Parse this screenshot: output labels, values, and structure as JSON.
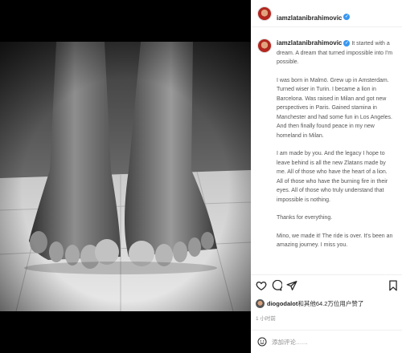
{
  "post": {
    "username": "iamzlatanibrahimovic",
    "caption_paragraphs": [
      "It started with a dream. A dream that turned impossible into I'm possible.",
      "I was born in Malmö. Grew up in Amsterdam. Turned wiser in Turin. I became a lion in Barcelona. Was raised in Milan and got new perspectives in Paris. Gained stamina in Manchester and had some fun in Los Angeles. And then finally found peace in my new homeland in Milan.",
      "I am made by you. And the legacy I hope to leave behind is all the new Zlatans made by me. All of those who have the heart of a lion. All of those who have the burning fire in their eyes. All of those who truly understand that impossible is nothing.",
      "Thanks for everything.",
      "Mino, we made it! The ride is over. It's been an amazing journey. I miss you."
    ]
  },
  "likes": {
    "user": "diogodalot",
    "text": "和其他64.2万位用户赞了"
  },
  "time_ago": "1 小时前",
  "comment": {
    "placeholder": "添加评论……"
  },
  "icons": {
    "like": "heart-icon",
    "comment": "comment-icon",
    "share": "paper-plane-icon",
    "save": "bookmark-icon",
    "emoji": "smiley-icon",
    "verified": "verified-badge-icon"
  }
}
